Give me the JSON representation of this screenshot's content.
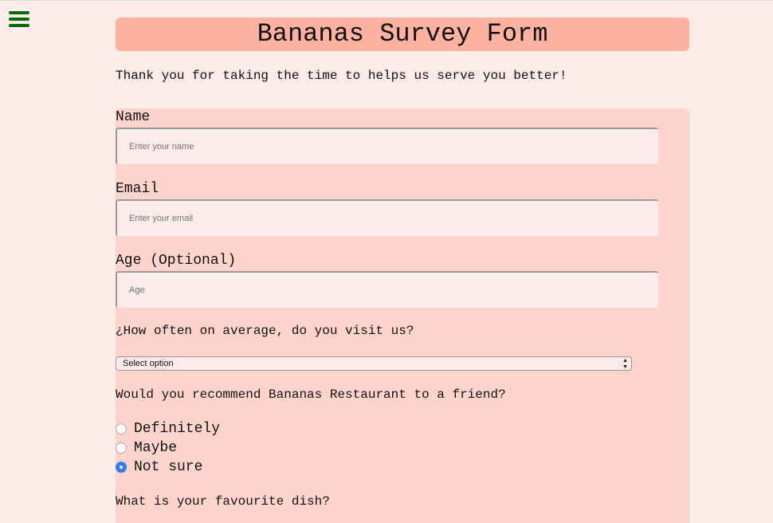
{
  "title": "Bananas Survey Form",
  "intro": "Thank you for taking the time to helps us serve you better!",
  "form": {
    "name_label": "Name",
    "name_placeholder": "Enter your name",
    "email_label": "Email",
    "email_placeholder": "Enter your email",
    "age_label": "Age (Optional)",
    "age_placeholder": "Age",
    "visit_question": "¿How often on average, do you visit us?",
    "visit_select": "Select option",
    "recommend_question": "Would you recommend Bananas Restaurant to a friend?",
    "options": [
      {
        "label": "Definitely",
        "checked": false
      },
      {
        "label": "Maybe",
        "checked": false
      },
      {
        "label": "Not sure",
        "checked": true
      }
    ],
    "dish_question": "What is your favourite dish?"
  }
}
